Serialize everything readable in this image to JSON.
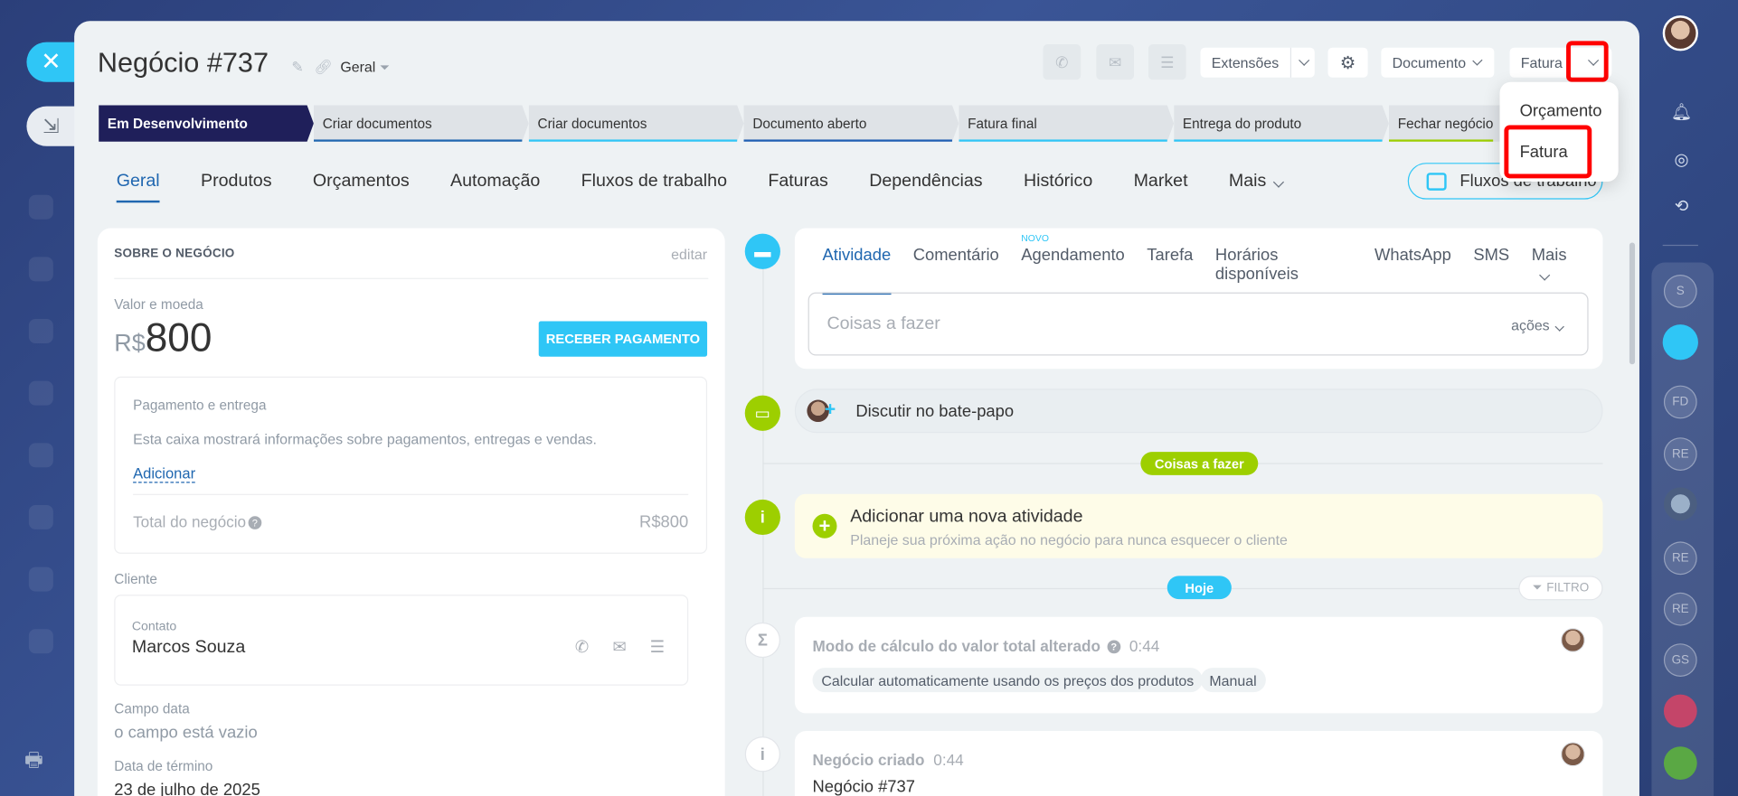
{
  "header": {
    "title": "Negócio #737",
    "category": "Geral",
    "extensions_label": "Extensões",
    "document_label": "Documento",
    "invoice_label": "Fatura"
  },
  "stages": [
    {
      "label": "Em Desenvolvimento",
      "color": "#1f1f5a"
    },
    {
      "label": "Criar documentos",
      "color": "#2067b0"
    },
    {
      "label": "Criar documentos",
      "color": "#2fc6f6"
    },
    {
      "label": "Documento aberto",
      "color": "#1f5fb3"
    },
    {
      "label": "Fatura final",
      "color": "#2fc6f6"
    },
    {
      "label": "Entrega do produto",
      "color": "#2fc6f6"
    },
    {
      "label": "Fechar negócio",
      "color": "#9dcf00"
    }
  ],
  "tabs": [
    "Geral",
    "Produtos",
    "Orçamentos",
    "Automação",
    "Fluxos de trabalho",
    "Faturas",
    "Dependências",
    "Histórico",
    "Market",
    "Mais"
  ],
  "workflow_button": "Fluxos de trabalho",
  "deal": {
    "section_title": "SOBRE O NEGÓCIO",
    "edit": "editar",
    "value_label": "Valor e moeda",
    "currency": "R$",
    "amount": "800",
    "pay_button": "RECEBER PAGAMENTO",
    "payment_title": "Pagamento e entrega",
    "payment_desc": "Esta caixa mostrará informações sobre pagamentos, entregas e vendas.",
    "add_link": "Adicionar",
    "total_label": "Total do negócio",
    "total_value": "R$800",
    "client_label": "Cliente",
    "contact_label": "Contato",
    "contact_name": "Marcos Souza",
    "date_field_label": "Campo data",
    "date_field_value": "o campo está vazio",
    "end_date_label": "Data de término",
    "end_date_value": "23 de julho de 2025"
  },
  "activity": {
    "tabs": [
      "Atividade",
      "Comentário",
      "Agendamento",
      "Tarefa",
      "Horários disponíveis",
      "WhatsApp",
      "SMS",
      "Mais"
    ],
    "new_badge": "NOVO",
    "todo_placeholder": "Coisas a fazer",
    "actions": "ações",
    "chat_text": "Discutir no bate-papo",
    "todo_pill": "Coisas a fazer",
    "new_title": "Adicionar uma nova atividade",
    "new_subtitle": "Planeje sua próxima ação no negócio para nunca esquecer o cliente",
    "today_pill": "Hoje",
    "filter": "FILTRO",
    "event1_title": "Modo de cálculo do valor total alterado",
    "event1_time": "0:44",
    "event1_from": "Calcular automaticamente usando os preços dos produtos",
    "event1_to": "Manual",
    "event2_title": "Negócio criado",
    "event2_time": "0:44",
    "event2_body": "Negócio #737"
  },
  "dropdown": {
    "items": [
      "Orçamento",
      "Fatura"
    ]
  },
  "right_rail": {
    "initials": [
      "S",
      "FD",
      "RE",
      "RE",
      "RE",
      "GS"
    ]
  },
  "colors": {
    "accent": "#2fc6f6",
    "link": "#2067b0",
    "green": "#9dcf00",
    "highlight": "#ff0000"
  }
}
